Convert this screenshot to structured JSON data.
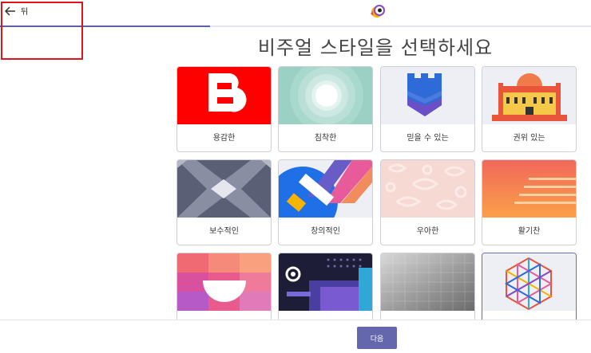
{
  "header": {
    "back_label": "뒤"
  },
  "page": {
    "title": "비주얼 스타일을 선택하세요"
  },
  "progress": {
    "fraction": 0.355
  },
  "styles": [
    {
      "label": "용감한"
    },
    {
      "label": "침착한"
    },
    {
      "label": "믿을 수 있는"
    },
    {
      "label": "권위 있는"
    },
    {
      "label": "보수적인"
    },
    {
      "label": "창의적인"
    },
    {
      "label": "우아한"
    },
    {
      "label": "활기찬"
    },
    {
      "label": ""
    },
    {
      "label": ""
    },
    {
      "label": ""
    },
    {
      "label": ""
    }
  ],
  "footer": {
    "next_label": "다음"
  },
  "colors": {
    "accent": "#6467ad",
    "highlight": "#e0121b"
  }
}
